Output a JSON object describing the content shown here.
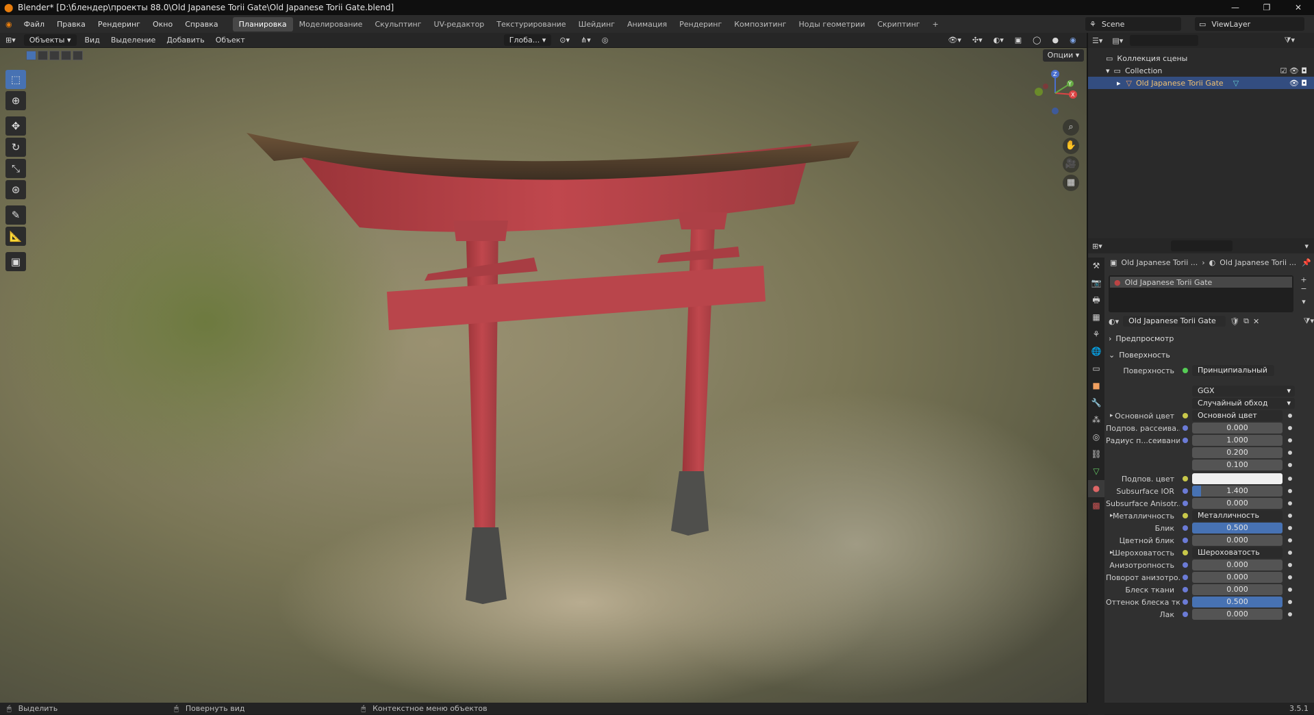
{
  "title": "Blender* [D:\\блендер\\проекты 88.0\\Old Japanese Torii Gate\\Old Japanese Torii Gate.blend]",
  "menu": [
    "Файл",
    "Правка",
    "Рендеринг",
    "Окно",
    "Справка"
  ],
  "workspaces": [
    "Планировка",
    "Моделирование",
    "Скульптинг",
    "UV-редактор",
    "Текстурирование",
    "Шейдинг",
    "Анимация",
    "Рендеринг",
    "Композитинг",
    "Ноды геометрии",
    "Скриптинг",
    "+"
  ],
  "scene": "Scene",
  "viewlayer": "ViewLayer",
  "header3d": {
    "mode": "Объекты",
    "items": [
      "Вид",
      "Выделение",
      "Добавить",
      "Объект"
    ],
    "transform": "Глоба...",
    "options": "Опции"
  },
  "outliner": {
    "scene_collection": "Коллекция сцены",
    "collection": "Collection",
    "object": "Old Japanese Torii Gate"
  },
  "props": {
    "breadcrumb1": "Old Japanese Torii ...",
    "breadcrumb2": "Old Japanese Torii ...",
    "slot": "Old Japanese Torii Gate",
    "material": "Old Japanese Torii Gate",
    "preview": "Предпросмотр",
    "surface_section": "Поверхность",
    "surface_label": "Поверхность",
    "surface_value": "Принципиальный BSDF",
    "distribution": "GGX",
    "sss_method": "Случайный обход",
    "rows": [
      {
        "label": "Основной цвет",
        "value": "Основной цвет",
        "kind": "link"
      },
      {
        "label": "Подпов. рассеива...",
        "value": "0.000",
        "kind": "num",
        "fill": 0
      },
      {
        "label": "Радиус п...сеивания",
        "value": "1.000",
        "kind": "num",
        "fill": 0
      },
      {
        "label": "",
        "value": "0.200",
        "kind": "num",
        "fill": 0
      },
      {
        "label": "",
        "value": "0.100",
        "kind": "num",
        "fill": 0
      },
      {
        "label": "Подпов. цвет",
        "value": "",
        "kind": "color"
      },
      {
        "label": "Subsurface IOR",
        "value": "1.400",
        "kind": "num",
        "fill": 0.1
      },
      {
        "label": "Subsurface Anisotr...",
        "value": "0.000",
        "kind": "num",
        "fill": 0
      },
      {
        "label": "Металличность",
        "value": "Металличность",
        "kind": "link"
      },
      {
        "label": "Блик",
        "value": "0.500",
        "kind": "num",
        "fill": 1
      },
      {
        "label": "Цветной блик",
        "value": "0.000",
        "kind": "num",
        "fill": 0
      },
      {
        "label": "Шероховатость",
        "value": "Шероховатость",
        "kind": "link"
      },
      {
        "label": "Анизотропность",
        "value": "0.000",
        "kind": "num",
        "fill": 0
      },
      {
        "label": "Поворот анизотро...",
        "value": "0.000",
        "kind": "num",
        "fill": 0
      },
      {
        "label": "Блеск ткани",
        "value": "0.000",
        "kind": "num",
        "fill": 0
      },
      {
        "label": "Оттенок блеска тк...",
        "value": "0.500",
        "kind": "num",
        "fill": 1
      },
      {
        "label": "Лак",
        "value": "0.000",
        "kind": "num",
        "fill": 0
      }
    ]
  },
  "status": {
    "select": "Выделить",
    "rotate": "Повернуть вид",
    "context": "Контекстное меню объектов",
    "version": "3.5.1"
  },
  "colors": {
    "accent": "#4772b3",
    "torii_red": "#b8434a",
    "roof": "#5a4630"
  }
}
